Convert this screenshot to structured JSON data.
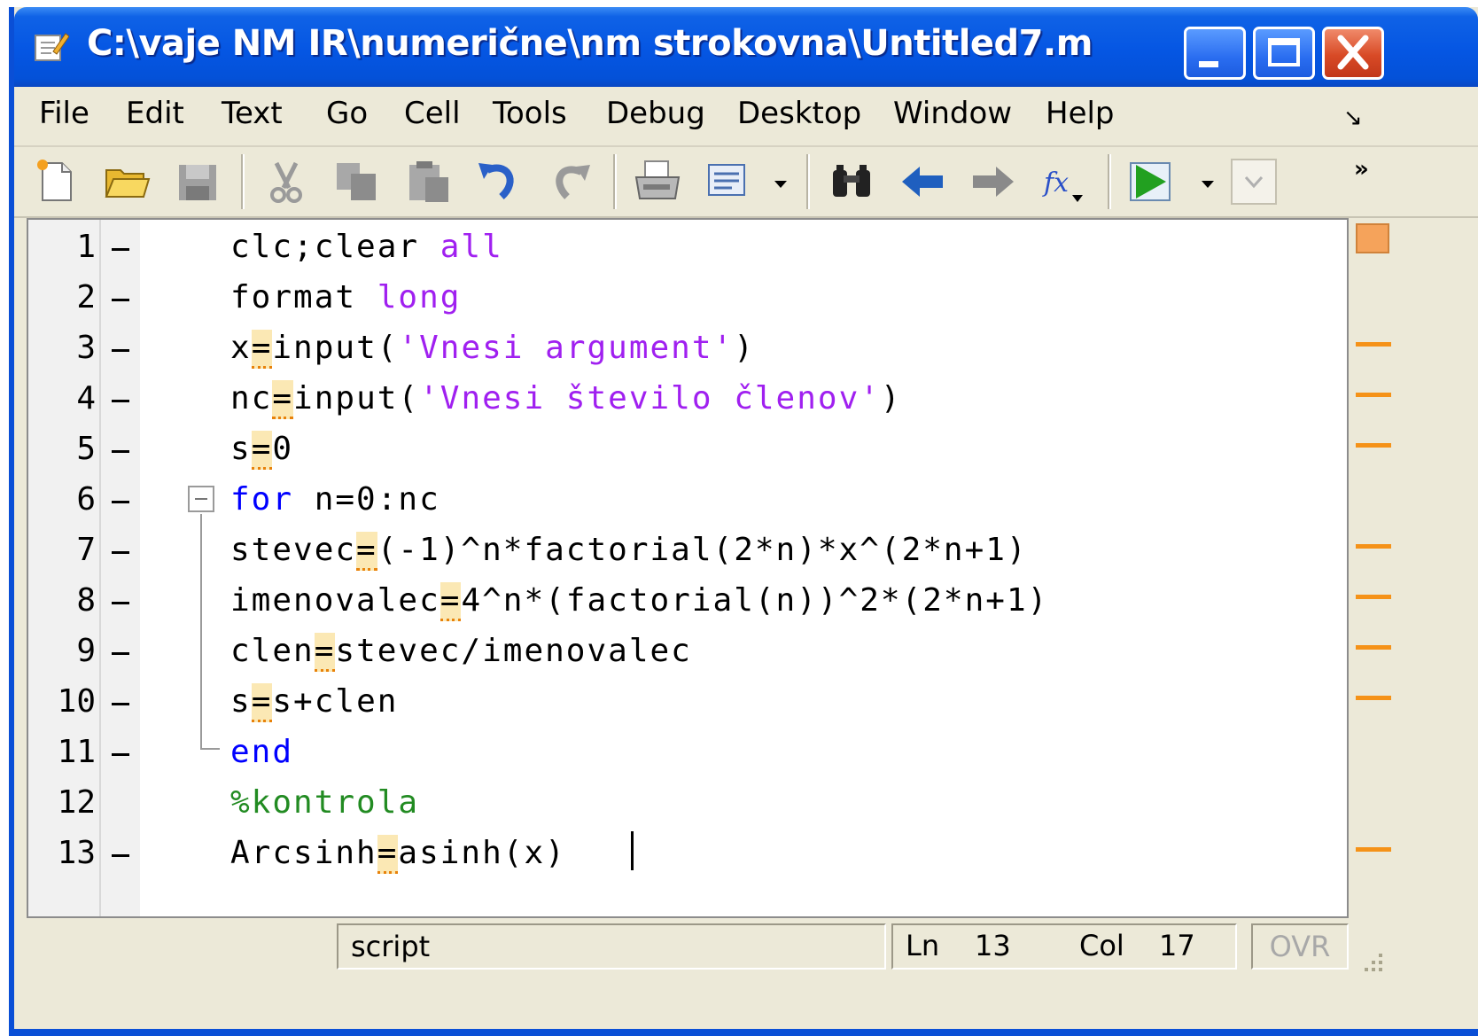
{
  "window": {
    "title": "C:\\vaje NM IR\\numerične\\nm strokovna\\Untitled7.m",
    "controls": [
      "minimize",
      "maximize",
      "close"
    ]
  },
  "menu": {
    "file": "File",
    "edit": "Edit",
    "text": "Text",
    "go": "Go",
    "cell": "Cell",
    "tools": "Tools",
    "debug": "Debug",
    "desktop": "Desktop",
    "window": "Window",
    "help": "Help",
    "dock": "↘"
  },
  "toolbar": {
    "icons": [
      "new-file-icon",
      "open-folder-icon",
      "save-icon",
      "cut-icon",
      "copy-icon",
      "paste-icon",
      "undo-icon",
      "redo-icon",
      "print-icon",
      "find-files-icon",
      "find-icon",
      "back-icon",
      "forward-icon",
      "function-icon",
      "run-icon",
      "more-icon"
    ],
    "more_label": "»"
  },
  "editor": {
    "lines": [
      {
        "n": "1",
        "breakpoint": true
      },
      {
        "n": "2",
        "breakpoint": true
      },
      {
        "n": "3",
        "breakpoint": true
      },
      {
        "n": "4",
        "breakpoint": true
      },
      {
        "n": "5",
        "breakpoint": true
      },
      {
        "n": "6",
        "breakpoint": true
      },
      {
        "n": "7",
        "breakpoint": true
      },
      {
        "n": "8",
        "breakpoint": true
      },
      {
        "n": "9",
        "breakpoint": true
      },
      {
        "n": "10",
        "breakpoint": true
      },
      {
        "n": "11",
        "breakpoint": true
      },
      {
        "n": "12",
        "breakpoint": false
      },
      {
        "n": "13",
        "breakpoint": true
      }
    ],
    "code": {
      "l1a": "clc;clear ",
      "l1b": "all",
      "l2a": "format ",
      "l2b": "long",
      "l3a": "x",
      "l3eq": "=",
      "l3b": "input(",
      "l3c": "'Vnesi argument'",
      "l3d": ")",
      "l4a": "nc",
      "l4eq": "=",
      "l4b": "input(",
      "l4c": "'Vnesi število členov'",
      "l4d": ")",
      "l5a": "s",
      "l5eq": "=",
      "l5b": "0",
      "l6a": "for",
      "l6b": " n=0:nc",
      "l7a": "stevec",
      "l7eq": "=",
      "l7b": "(-1)^n*factorial(2*n)*x^(2*n+1)",
      "l8a": "imenovalec",
      "l8eq": "=",
      "l8b": "4^n*(factorial(n))^2*(2*n+1)",
      "l9a": "clen",
      "l9eq": "=",
      "l9b": "stevec/imenovalec",
      "l10a": "s",
      "l10eq": "=",
      "l10b": "s+clen",
      "l11a": "end",
      "l12a": "%kontrola",
      "l13a": "Arcsinh",
      "l13eq": "=",
      "l13b": "asinh(x)"
    }
  },
  "status": {
    "type": "script",
    "ln_label": "Ln",
    "ln_value": "13",
    "col_label": "Col",
    "col_value": "17",
    "ovr": "OVR"
  },
  "colors": {
    "keyword": "#0000ff",
    "string": "#a020f0",
    "comment": "#228b22",
    "warning_marker": "#f59218",
    "titlebar": "#0556e3"
  }
}
